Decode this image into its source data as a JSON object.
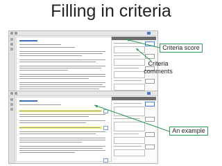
{
  "slide": {
    "title": "Filling in criteria"
  },
  "callouts": {
    "criteria_score": "Criteria score",
    "criteria_comments": "Criteria\ncomments",
    "an_example": "An example"
  },
  "colors": {
    "callout_border": "#2e9a5a",
    "highlight": "#f0f06a",
    "accent": "#3c78d8"
  }
}
